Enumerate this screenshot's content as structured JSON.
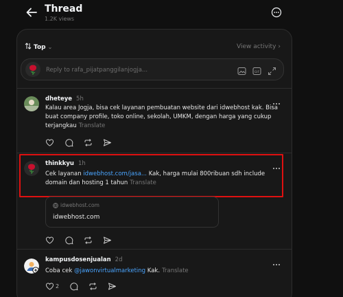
{
  "header": {
    "title": "Thread",
    "views": "1.2K views"
  },
  "sort": {
    "label": "Top",
    "view_activity": "View activity"
  },
  "reply": {
    "placeholder": "Reply to rafa_pijatpanggilanjogja..."
  },
  "posts": [
    {
      "username": "dheteye",
      "time": "5h",
      "text": "Kalau area Jogja, bisa cek layanan pembuatan website dari idwebhost kak. Bisa buat company profile, toko online, sekolah, UMKM, dengan harga yang cukup terjangkau",
      "translate": "Translate"
    },
    {
      "username": "thinkkyu",
      "time": "1h",
      "text_before": "Cek layanan",
      "link": "idwebhost.com/jasa...",
      "text_after": "Kak, harga mulai 800ribuan sdh include domain dan hosting 1 tahun",
      "translate": "Translate",
      "card": {
        "domain_small": "idwebhost.com",
        "domain_big": "idwebhost.com"
      }
    },
    {
      "username": "kampusdosenjualan",
      "time": "2d",
      "text_before": "Coba cek",
      "mention": "@jawonvirtualmarketing",
      "text_after": "Kak.",
      "translate": "Translate",
      "like_count": "2"
    }
  ],
  "colors": {
    "background": "#101010",
    "panel": "#181818",
    "link": "#4aa5ff",
    "highlight": "#e01010"
  },
  "icons": [
    "back-arrow-icon",
    "more-icon",
    "chevron-down-icon",
    "chevron-right-icon",
    "image-icon",
    "gif-icon",
    "expand-icon",
    "heart-icon",
    "comment-icon",
    "repost-icon",
    "share-icon",
    "globe-icon"
  ]
}
